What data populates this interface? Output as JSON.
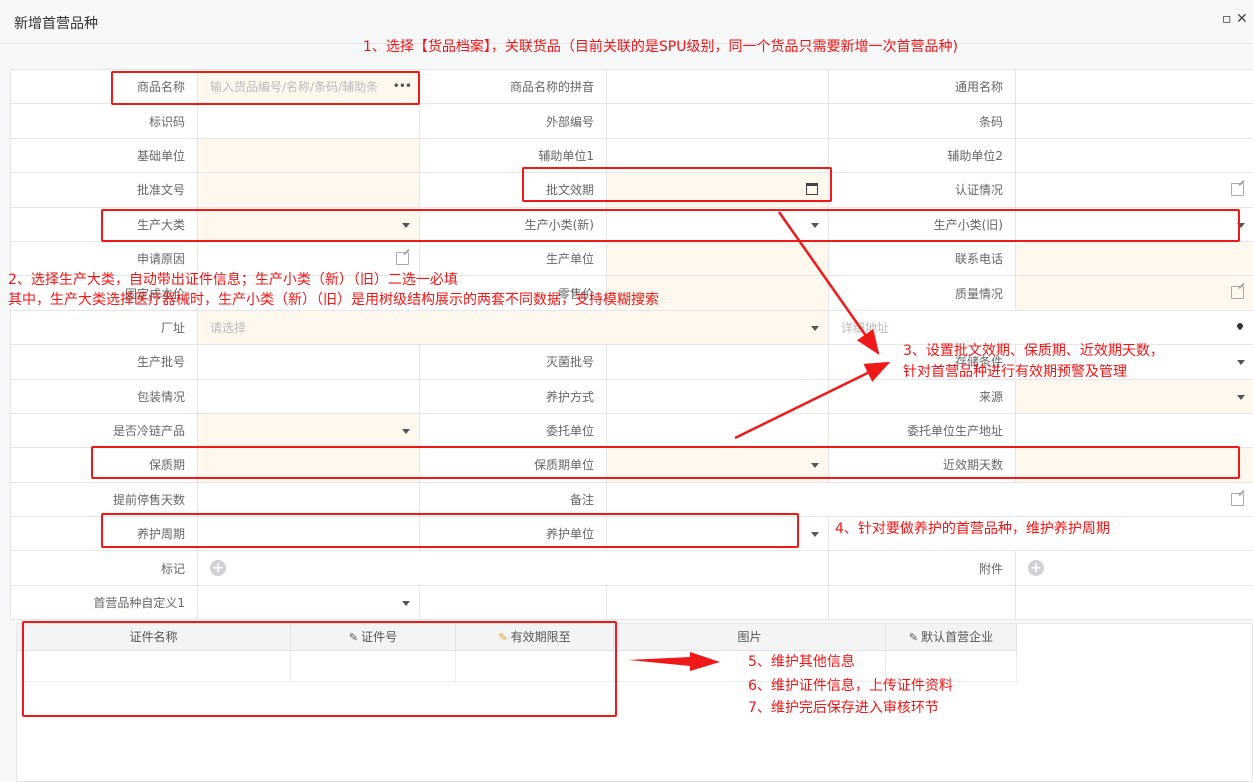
{
  "window": {
    "title": "新增首营品种",
    "restore_icon": "maximize-icon",
    "close_icon": "close-icon"
  },
  "form": {
    "product_name_label": "商品名称",
    "product_name_placeholder": "输入货品编号/名称/条码/辅助条",
    "pinyin_label": "商品名称的拼音",
    "generic_name_label": "通用名称",
    "id_code_label": "标识码",
    "external_no_label": "外部编号",
    "barcode_label": "条码",
    "base_unit_label": "基础单位",
    "aux_unit1_label": "辅助单位1",
    "aux_unit2_label": "辅助单位2",
    "approval_no_label": "批准文号",
    "approval_validity_label": "批文效期",
    "certification_label": "认证情况",
    "prod_category_label": "生产大类",
    "prod_sub_new_label": "生产小类(新)",
    "prod_sub_old_label": "生产小类(旧)",
    "apply_reason_label": "申请原因",
    "manufacturer_label": "生产单位",
    "contact_phone_label": "联系电话",
    "fixed_cost_label": "固定成本价",
    "retail_price_label": "零售价",
    "quality_label": "质量情况",
    "factory_address_label": "厂址",
    "factory_address_placeholder": "请选择",
    "address_detail_placeholder": "详细地址",
    "batch_no_label": "生产批号",
    "sterile_batch_label": "灭菌批号",
    "storage_label": "存储条件",
    "packing_label": "包装情况",
    "maintain_method_label": "养护方式",
    "source_label": "来源",
    "cold_chain_label": "是否冷链产品",
    "entrusted_unit_label": "委托单位",
    "entrusted_address_label": "委托单位生产地址",
    "shelf_life_label": "保质期",
    "shelf_life_unit_label": "保质期单位",
    "near_expiry_days_label": "近效期天数",
    "stop_sale_days_label": "提前停售天数",
    "remark_label": "备注",
    "maintain_cycle_label": "养护周期",
    "maintain_unit_label": "养护单位",
    "mark_label": "标记",
    "attachment_label": "附件",
    "custom1_label": "首营品种自定义1"
  },
  "cert_grid": {
    "headers": [
      "证件名称",
      "证件号",
      "有效期限至",
      "图片",
      "默认首营企业"
    ]
  },
  "annotations": {
    "note1": "1、选择【货品档案】，关联货品（目前关联的是SPU级别，同一个货品只需要新增一次首营品种)",
    "note2_line1": "2、选择生产大类，自动带出证件信息；生产小类（新）（旧）二选一必填",
    "note2_line2": "其中，生产大类选择医疗器械时，生产小类（新）（旧）是用树级结构展示的两套不同数据，支持模糊搜索",
    "note3_line1": "3、设置批文效期、保质期、近效期天数，",
    "note3_line2": "针对首营品种进行有效期预警及管理",
    "note4": "4、针对要做养护的首营品种，维护养护周期",
    "note5": "5、维护其他信息",
    "note6": "6、维护证件信息，上传证件资料",
    "note7": "7、维护完后保存进入审核环节"
  },
  "colors": {
    "annotation_red": "#f01919",
    "required_bg": "#fff8ee"
  }
}
